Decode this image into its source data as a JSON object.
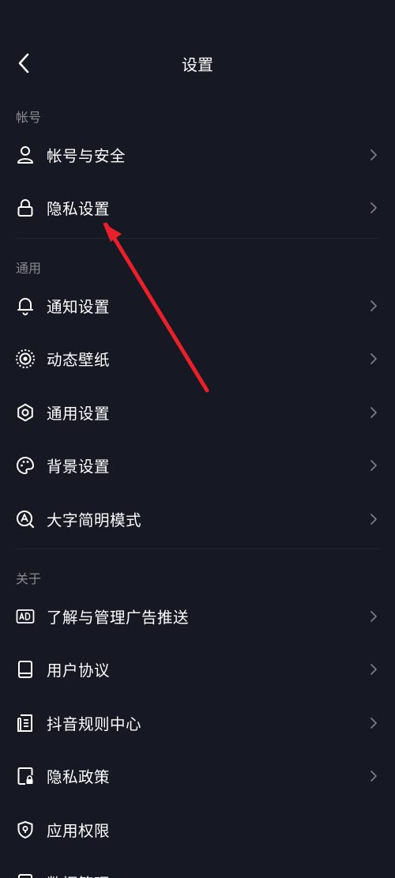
{
  "header": {
    "title": "设置",
    "back_icon": "chevron-left-icon"
  },
  "sections": [
    {
      "label": "帐号"
    },
    {
      "label": "通用"
    },
    {
      "label": "关于"
    }
  ],
  "items": [
    {
      "label": "帐号与安全",
      "icon": "user-icon"
    },
    {
      "label": "隐私设置",
      "icon": "lock-icon"
    },
    {
      "label": "通知设置",
      "icon": "bell-icon"
    },
    {
      "label": "动态壁纸",
      "icon": "live-wallpaper-icon"
    },
    {
      "label": "通用设置",
      "icon": "gear-icon"
    },
    {
      "label": "背景设置",
      "icon": "palette-icon"
    },
    {
      "label": "大字简明模式",
      "icon": "large-text-icon"
    },
    {
      "label": "了解与管理广告推送",
      "icon": "ad-icon"
    },
    {
      "label": "用户协议",
      "icon": "book-icon"
    },
    {
      "label": "抖音规则中心",
      "icon": "document-icon"
    },
    {
      "label": "隐私政策",
      "icon": "privacy-file-icon"
    },
    {
      "label": "应用权限",
      "icon": "shield-icon"
    },
    {
      "label": "数据管理",
      "icon": "data-icon"
    }
  ],
  "colors": {
    "background": "#161823",
    "section_text": "#8a8b91",
    "chevron": "#7b7c83",
    "annotation_arrow": "#e8202a"
  }
}
